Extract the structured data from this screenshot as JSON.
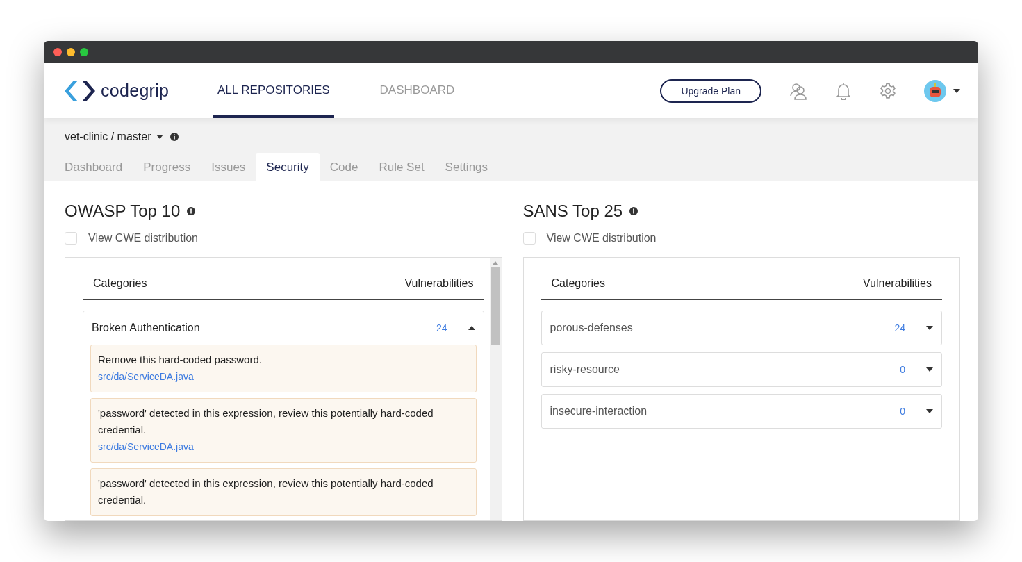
{
  "header": {
    "logo": "codegrip",
    "nav": [
      {
        "label": "ALL REPOSITORIES",
        "selected": true
      },
      {
        "label": "DASHBOARD",
        "selected": false
      }
    ],
    "upgrade_button": "Upgrade Plan"
  },
  "repo": {
    "label": "vet-clinic / master"
  },
  "tabs": [
    {
      "label": "Dashboard",
      "selected": false
    },
    {
      "label": "Progress",
      "selected": false
    },
    {
      "label": "Issues",
      "selected": false
    },
    {
      "label": "Security",
      "selected": true
    },
    {
      "label": "Code",
      "selected": false
    },
    {
      "label": "Rule Set",
      "selected": false
    },
    {
      "label": "Settings",
      "selected": false
    }
  ],
  "panels": [
    {
      "title": "OWASP Top 10",
      "checkbox": {
        "label": "View CWE distribution",
        "checked": false
      },
      "columns": [
        "Categories",
        "Vulnerabilities"
      ],
      "scrollable": true,
      "categories": [
        {
          "name": "Broken Authentication",
          "count": "24",
          "expanded": true,
          "issues": [
            {
              "message": "Remove this hard-coded password.",
              "file": "src/da/ServiceDA.java"
            },
            {
              "message": "'password' detected in this expression, review this potentially hard-coded credential.",
              "file": "src/da/ServiceDA.java"
            },
            {
              "message": "'password' detected in this expression, review this potentially hard-coded credential."
            }
          ]
        }
      ]
    },
    {
      "title": "SANS Top 25",
      "checkbox": {
        "label": "View CWE distribution",
        "checked": false
      },
      "columns": [
        "Categories",
        "Vulnerabilities"
      ],
      "scrollable": false,
      "categories": [
        {
          "name": "porous-defenses",
          "count": "24",
          "expanded": false
        },
        {
          "name": "risky-resource",
          "count": "0",
          "expanded": false
        },
        {
          "name": "insecure-interaction",
          "count": "0",
          "expanded": false
        }
      ]
    }
  ]
}
